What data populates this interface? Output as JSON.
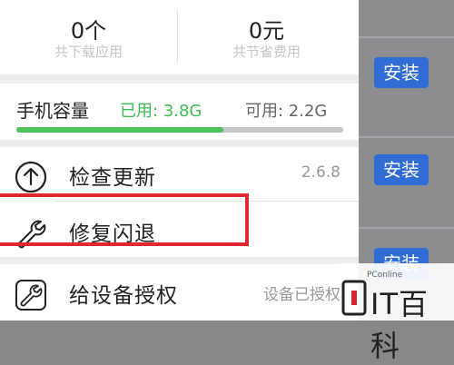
{
  "stats": [
    {
      "value": "0个",
      "label": "共下载应用"
    },
    {
      "value": "0元",
      "label": "共节省费用"
    }
  ],
  "storage": {
    "title": "手机容量",
    "used": "已用: 3.8G",
    "available": "可用: 2.2G",
    "used_fraction": 0.633
  },
  "menu": [
    {
      "label": "检查更新",
      "value": "2.6.8",
      "icon": "upload-icon"
    },
    {
      "label": "修复闪退",
      "value": "",
      "icon": "wrench-icon"
    },
    {
      "label": "给设备授权",
      "value": "设备已授权",
      "icon": "wrench-icon"
    }
  ],
  "background": {
    "install_label": "安装"
  },
  "watermark": {
    "small": "PConline",
    "text": "IT百科"
  },
  "colors": {
    "install_button": "#2f6dd4",
    "used_text": "#3dbb53",
    "highlight": "#e0262f"
  }
}
